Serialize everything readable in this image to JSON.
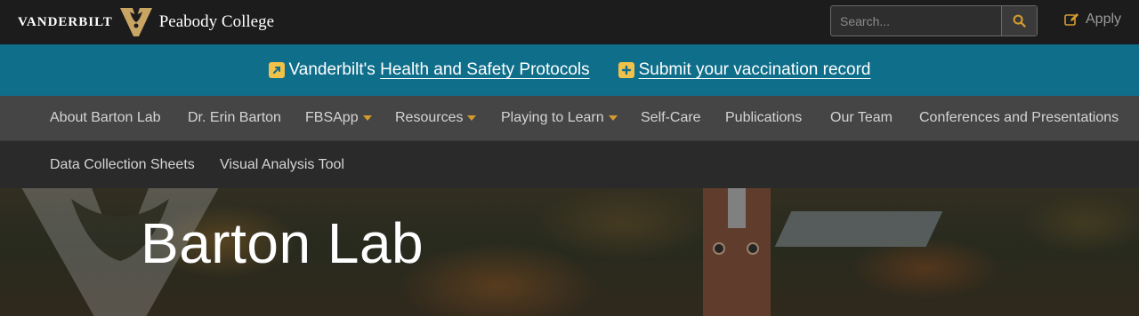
{
  "header": {
    "brand_word": "VANDERBILT",
    "brand_college": "Peabody College",
    "search_placeholder": "Search...",
    "apply_label": "Apply",
    "accent_color": "#d39b2f"
  },
  "alerts": [
    {
      "prefix": "Vanderbilt's",
      "link": "Health and Safety Protocols",
      "icon": "external-link-icon"
    },
    {
      "prefix": "",
      "link": "Submit your vaccination record",
      "icon": "plus-square-icon"
    }
  ],
  "nav": {
    "row1": [
      {
        "label": "About Barton Lab",
        "dropdown": false
      },
      {
        "label": "Dr. Erin Barton",
        "dropdown": false
      },
      {
        "label": "FBSApp",
        "dropdown": true
      },
      {
        "label": "Resources",
        "dropdown": true
      },
      {
        "label": "Playing to Learn",
        "dropdown": true
      },
      {
        "label": "Self-Care",
        "dropdown": false
      },
      {
        "label": "Publications",
        "dropdown": false
      },
      {
        "label": "Our Team",
        "dropdown": false
      },
      {
        "label": "Conferences and Presentations",
        "dropdown": false
      }
    ],
    "row2": [
      {
        "label": "Data Collection Sheets",
        "dropdown": false
      },
      {
        "label": "Visual Analysis Tool",
        "dropdown": false
      }
    ]
  },
  "hero": {
    "title": "Barton Lab"
  }
}
